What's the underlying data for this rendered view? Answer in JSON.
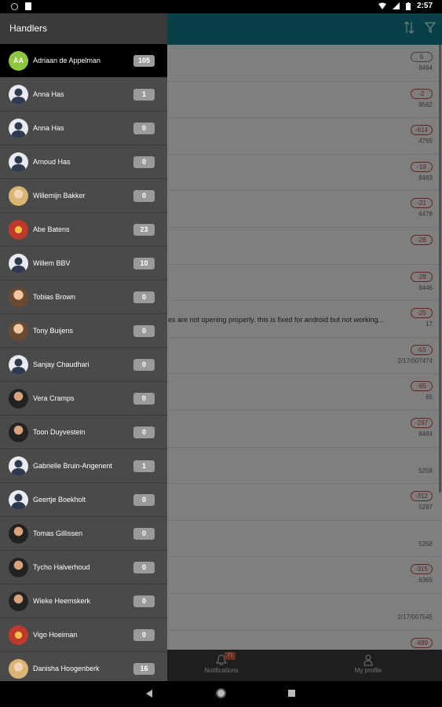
{
  "status_bar": {
    "time": "2:57"
  },
  "drawer": {
    "title": "Handlers",
    "handlers": [
      {
        "name": "Adriaan de Appelman",
        "count": "105",
        "avatar": "initials",
        "initials": "AA",
        "active": true
      },
      {
        "name": "Anna Has",
        "count": "1",
        "avatar": "placeholder"
      },
      {
        "name": "Anna Has",
        "count": "0",
        "avatar": "placeholder"
      },
      {
        "name": "Arnoud Has",
        "count": "0",
        "avatar": "placeholder"
      },
      {
        "name": "Willemijn Bakker",
        "count": "0",
        "avatar": "photo-blond"
      },
      {
        "name": "Abe Batens",
        "count": "23",
        "avatar": "photo-red"
      },
      {
        "name": "Willem BBV",
        "count": "10",
        "avatar": "placeholder"
      },
      {
        "name": "Tobias Brown",
        "count": "0",
        "avatar": "photo"
      },
      {
        "name": "Tony Buijens",
        "count": "0",
        "avatar": "photo"
      },
      {
        "name": "Sanjay Chaudhari",
        "count": "0",
        "avatar": "placeholder"
      },
      {
        "name": "Vera Cramps",
        "count": "0",
        "avatar": "photo-dark"
      },
      {
        "name": "Toon Duyvestein",
        "count": "0",
        "avatar": "photo-dark"
      },
      {
        "name": "Gabrielle Bruin-Angenent",
        "count": "1",
        "avatar": "placeholder"
      },
      {
        "name": "Geertje Boekholt",
        "count": "0",
        "avatar": "placeholder"
      },
      {
        "name": "Tomas Gillissen",
        "count": "0",
        "avatar": "photo-dark"
      },
      {
        "name": "Tycho Halverhoud",
        "count": "0",
        "avatar": "photo-dark"
      },
      {
        "name": "Wieke Heemskerk",
        "count": "0",
        "avatar": "photo-dark"
      },
      {
        "name": "Vigo Hoeiman",
        "count": "0",
        "avatar": "photo-red"
      },
      {
        "name": "Danisha Hoogenberk",
        "count": "16",
        "avatar": "photo-blond"
      }
    ]
  },
  "background_list": {
    "rows": [
      {
        "badge": "5",
        "sub": "8464",
        "neutral": true
      },
      {
        "badge": "-2",
        "sub": "8562"
      },
      {
        "badge": "-614",
        "sub": "4765"
      },
      {
        "badge": "-19",
        "sub": "8483"
      },
      {
        "badge": "-21",
        "sub": "6478"
      },
      {
        "badge": "-28",
        "sub": ""
      },
      {
        "badge": "-28",
        "sub": "8446"
      },
      {
        "badge": "-25",
        "sub": "17",
        "text": "es are not opening properly. this is fixed for android but not working..."
      },
      {
        "badge": "-55",
        "sub": "2/17/007474"
      },
      {
        "badge": "-65",
        "sub": "65"
      },
      {
        "badge": "-297",
        "sub": "8484"
      },
      {
        "badge": "",
        "sub": "5258"
      },
      {
        "badge": "-312",
        "sub": "5297"
      },
      {
        "badge": "",
        "sub": "5258"
      },
      {
        "badge": "-315",
        "sub": "6365"
      },
      {
        "badge": "",
        "sub": "2/17/007545"
      },
      {
        "badge": "-489",
        "sub": ""
      }
    ]
  },
  "bottom_nav": {
    "notifications_label": "Notifications",
    "notifications_count": "71",
    "profile_label": "My profile"
  },
  "colors": {
    "header": "#0e7c8a",
    "active_row": "#000000",
    "badge_red": "#c8403c"
  }
}
